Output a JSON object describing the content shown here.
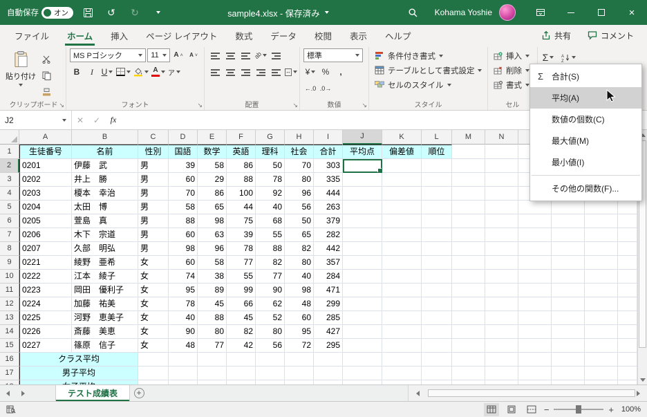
{
  "titlebar": {
    "autosave_label": "自動保存",
    "autosave_state": "オン",
    "title": "sample4.xlsx - 保存済み",
    "user": "Kohama Yoshie"
  },
  "ribbon_tabs": [
    "ファイル",
    "ホーム",
    "挿入",
    "ページ レイアウト",
    "数式",
    "データ",
    "校閲",
    "表示",
    "ヘルプ"
  ],
  "ribbon_right": {
    "share": "共有",
    "comments": "コメント"
  },
  "ribbon": {
    "paste": "貼り付け",
    "font_name": "MS Pゴシック",
    "font_size": "11",
    "number_format": "標準",
    "conditional_format": "条件付き書式",
    "format_as_table": "テーブルとして書式設定",
    "cell_styles": "セルのスタイル",
    "insert": "挿入",
    "delete": "削除",
    "format": "書式",
    "groups": {
      "clipboard": "クリップボード",
      "font": "フォント",
      "alignment": "配置",
      "number": "数値",
      "styles": "スタイル",
      "cells": "セル"
    },
    "glyphs": {
      "sum": "Σ",
      "bold": "B",
      "italic": "I",
      "underline": "U",
      "ruby": "ア",
      "currency": "¥",
      "percent": "%",
      "comma": ",",
      "inc_decimal": "←.0",
      "dec_decimal": ".0→",
      "grow_font": "A",
      "shrink_font": "A",
      "orientation": "ab",
      "merge_arrows": "↔"
    }
  },
  "sum_menu": {
    "items": [
      "合計(S)",
      "平均(A)",
      "数値の個数(C)",
      "最大値(M)",
      "最小値(I)",
      "その他の関数(F)..."
    ]
  },
  "formula_bar": {
    "name_box": "J2",
    "formula": "",
    "fx": "fx"
  },
  "grid": {
    "columns": [
      "A",
      "B",
      "C",
      "D",
      "E",
      "F",
      "G",
      "H",
      "I",
      "J",
      "K",
      "L",
      "M",
      "N"
    ],
    "row_count": 18,
    "selected_cell": "J2",
    "table_headers": [
      "生徒番号",
      "名前",
      "性別",
      "国語",
      "数学",
      "英語",
      "理科",
      "社会",
      "合計",
      "平均点",
      "偏差値",
      "順位"
    ],
    "students": [
      {
        "id": "0201",
        "name": "伊藤　武",
        "gender": "男",
        "scores": [
          39,
          58,
          86,
          50,
          70
        ],
        "total": 303
      },
      {
        "id": "0202",
        "name": "井上　勝",
        "gender": "男",
        "scores": [
          60,
          29,
          88,
          78,
          80
        ],
        "total": 335
      },
      {
        "id": "0203",
        "name": "榎本　幸治",
        "gender": "男",
        "scores": [
          70,
          86,
          100,
          92,
          96
        ],
        "total": 444
      },
      {
        "id": "0204",
        "name": "太田　博",
        "gender": "男",
        "scores": [
          58,
          65,
          44,
          40,
          56
        ],
        "total": 263
      },
      {
        "id": "0205",
        "name": "萱島　真",
        "gender": "男",
        "scores": [
          88,
          98,
          75,
          68,
          50
        ],
        "total": 379
      },
      {
        "id": "0206",
        "name": "木下　宗道",
        "gender": "男",
        "scores": [
          60,
          63,
          39,
          55,
          65
        ],
        "total": 282
      },
      {
        "id": "0207",
        "name": "久部　明弘",
        "gender": "男",
        "scores": [
          98,
          96,
          78,
          88,
          82
        ],
        "total": 442
      },
      {
        "id": "0221",
        "name": "綾野　亜希",
        "gender": "女",
        "scores": [
          60,
          58,
          77,
          82,
          80
        ],
        "total": 357
      },
      {
        "id": "0222",
        "name": "江本　綾子",
        "gender": "女",
        "scores": [
          74,
          38,
          55,
          77,
          40
        ],
        "total": 284
      },
      {
        "id": "0223",
        "name": "岡田　優利子",
        "gender": "女",
        "scores": [
          95,
          89,
          99,
          90,
          98
        ],
        "total": 471
      },
      {
        "id": "0224",
        "name": "加藤　祐美",
        "gender": "女",
        "scores": [
          78,
          45,
          66,
          62,
          48
        ],
        "total": 299
      },
      {
        "id": "0225",
        "name": "河野　恵美子",
        "gender": "女",
        "scores": [
          40,
          88,
          45,
          52,
          60
        ],
        "total": 285
      },
      {
        "id": "0226",
        "name": "斎藤　美恵",
        "gender": "女",
        "scores": [
          90,
          80,
          82,
          80,
          95
        ],
        "total": 427
      },
      {
        "id": "0227",
        "name": "篠原　信子",
        "gender": "女",
        "scores": [
          48,
          77,
          42,
          56,
          72
        ],
        "total": 295
      }
    ],
    "summary_rows": [
      "クラス平均",
      "男子平均",
      "女子平均"
    ]
  },
  "sheet_bar": {
    "active_tab": "テスト成績表"
  },
  "status_bar": {
    "zoom": "100%"
  }
}
